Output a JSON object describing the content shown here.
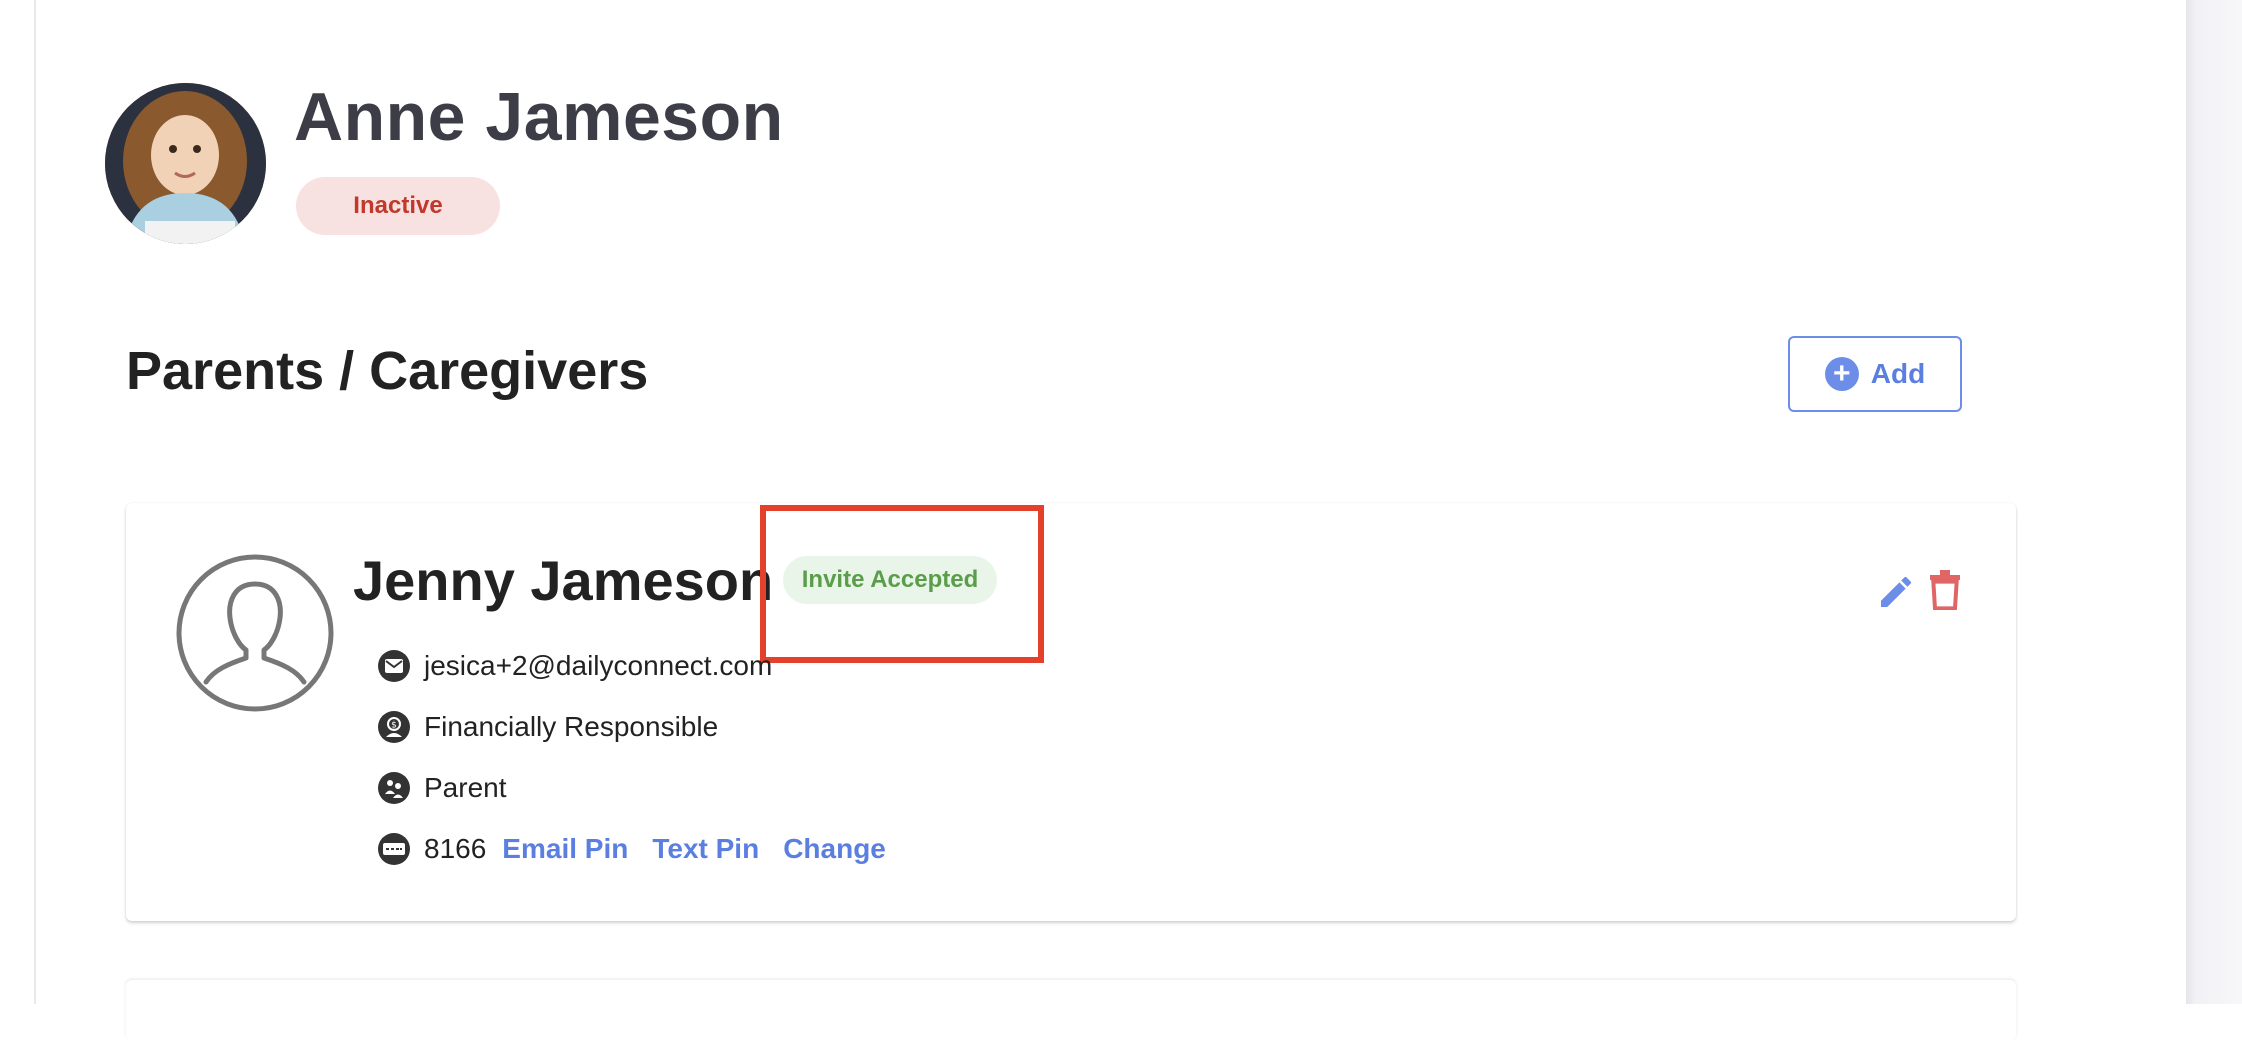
{
  "student": {
    "name": "Anne Jameson",
    "status": "Inactive"
  },
  "section": {
    "title": "Parents / Caregivers",
    "add_label": "Add"
  },
  "parent": {
    "name": "Jenny Jameson",
    "invite_status": "Invite Accepted",
    "email": "jesica+2@dailyconnect.com",
    "financial": "Financially Responsible",
    "relation": "Parent",
    "pin": "8166",
    "pin_actions": {
      "email": "Email Pin",
      "text": "Text Pin",
      "change": "Change"
    }
  },
  "colors": {
    "accent": "#5b7fe0",
    "inactive": "#c0392b",
    "accepted": "#5a9e4b",
    "delete": "#e06666",
    "highlight": "#e4402b"
  },
  "icons": [
    "plus-icon",
    "person-icon",
    "pencil-icon",
    "trash-icon",
    "envelope-icon",
    "dollar-person-icon",
    "family-icon",
    "pin-keyboard-icon"
  ]
}
